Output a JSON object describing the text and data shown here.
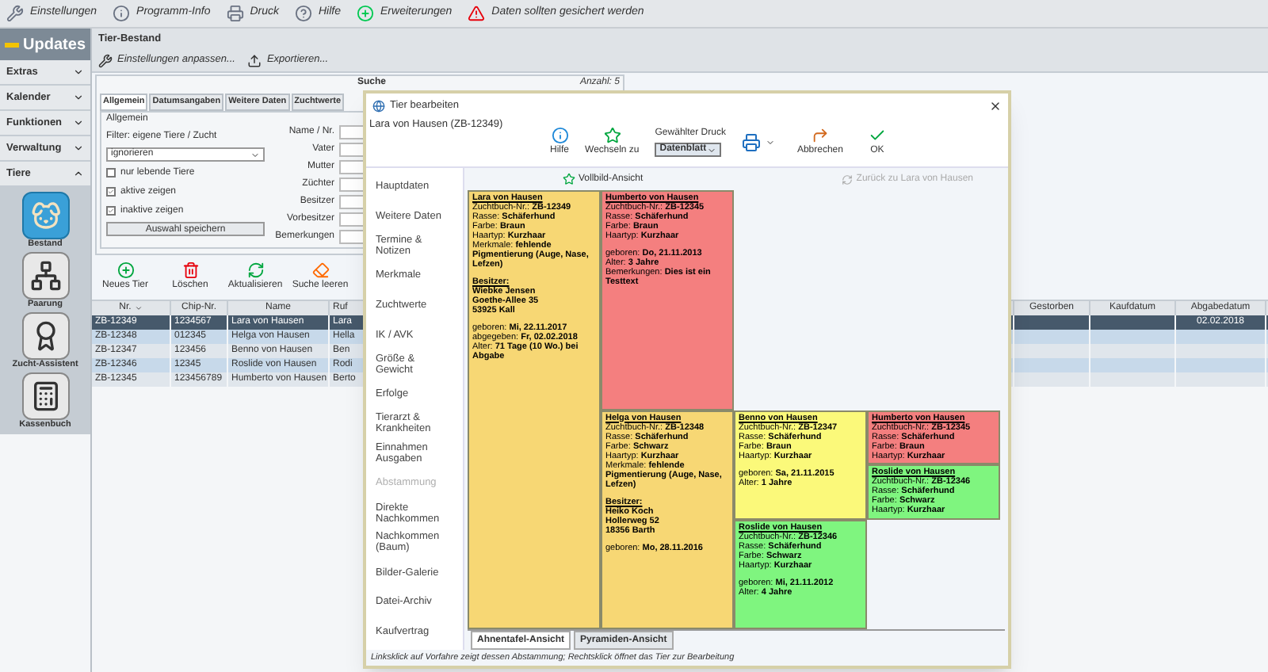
{
  "top_toolbar": [
    {
      "label": "Einstellungen"
    },
    {
      "label": "Programm-Info"
    },
    {
      "label": "Druck"
    },
    {
      "label": "Hilfe"
    },
    {
      "label": "Erweiterungen"
    },
    {
      "label": "Daten sollten gesichert werden"
    }
  ],
  "sidebar": {
    "title": "Updates",
    "sections": [
      {
        "label": "Extras",
        "expanded": false
      },
      {
        "label": "Kalender",
        "expanded": false
      },
      {
        "label": "Funktionen",
        "expanded": false
      },
      {
        "label": "Verwaltung",
        "expanded": false
      },
      {
        "label": "Tiere",
        "expanded": true
      }
    ],
    "modules": [
      {
        "label": "Bestand",
        "selected": true
      },
      {
        "label": "Paarung",
        "selected": false
      },
      {
        "label": "Zucht-Assistent",
        "selected": false
      },
      {
        "label": "Kassenbuch",
        "selected": false
      }
    ]
  },
  "main": {
    "title": "Tier-Bestand",
    "toolbar": [
      {
        "label": "Einstellungen anpassen..."
      },
      {
        "label": "Exportieren..."
      }
    ],
    "search": {
      "title": "Suche",
      "count": "Anzahl: 5",
      "tabs": [
        {
          "label": "Allgemein",
          "selected": true
        },
        {
          "label": "Datumsangaben",
          "selected": false
        },
        {
          "label": "Weitere Daten",
          "selected": false
        },
        {
          "label": "Zuchtwerte",
          "selected": false
        }
      ],
      "group_title": "Allgemein",
      "filter_label": "Filter: eigene Tiere / Zucht",
      "filter_value": "ignorieren",
      "checkboxes": [
        {
          "label": "nur lebende Tiere",
          "checked": false
        },
        {
          "label": "aktive zeigen",
          "checked": true
        },
        {
          "label": "inaktive zeigen",
          "checked": true
        }
      ],
      "save_button": "Auswahl speichern",
      "fields": [
        {
          "label": "Name / Nr."
        },
        {
          "label": "Vater"
        },
        {
          "label": "Mutter"
        },
        {
          "label": "Züchter"
        },
        {
          "label": "Besitzer"
        },
        {
          "label": "Vorbesitzer"
        },
        {
          "label": "Bemerkungen"
        }
      ]
    },
    "actions": [
      {
        "label": "Neues Tier"
      },
      {
        "label": "Löschen"
      },
      {
        "label": "Aktualisieren"
      },
      {
        "label": "Suche leeren"
      }
    ],
    "table": {
      "columns": [
        "Nr.",
        "Chip-Nr.",
        "Name",
        "Ruf",
        "Gestorben",
        "Kaufdatum",
        "Abgabedatum"
      ],
      "rows": [
        {
          "selected": true,
          "cells": [
            "ZB-12349",
            "1234567",
            "Lara von Hausen",
            "Lara",
            "",
            "",
            "02.02.2018"
          ]
        },
        {
          "selected": false,
          "cells": [
            "ZB-12348",
            "012345",
            "Helga von Hausen",
            "Hella",
            "",
            "",
            ""
          ]
        },
        {
          "selected": false,
          "cells": [
            "ZB-12347",
            "123456",
            "Benno von Hausen",
            "Ben",
            "",
            "",
            ""
          ]
        },
        {
          "selected": false,
          "cells": [
            "ZB-12346",
            "12345",
            "Roslide von Hausen",
            "Rodi",
            "",
            "",
            ""
          ]
        },
        {
          "selected": false,
          "cells": [
            "ZB-12345",
            "123456789",
            "Humberto von Hausen",
            "Berto",
            "",
            "",
            ""
          ]
        }
      ]
    }
  },
  "dialog": {
    "title": "Tier bearbeiten",
    "subtitle": "Lara von Hausen (ZB-12349)",
    "toolbar": {
      "help": "Hilfe",
      "switch": "Wechseln zu",
      "print_label": "Gewählter Druck",
      "print_value": "Datenblatt",
      "cancel": "Abbrechen",
      "ok": "OK"
    },
    "nav": [
      {
        "label": "Hauptdaten",
        "selected": false
      },
      {
        "label": "Weitere Daten",
        "selected": false
      },
      {
        "label": "Termine & Notizen",
        "selected": false
      },
      {
        "label": "Merkmale",
        "selected": false
      },
      {
        "label": "Zuchtwerte",
        "selected": false
      },
      {
        "label": "IK / AVK",
        "selected": false
      },
      {
        "label": "Größe & Gewicht",
        "selected": false
      },
      {
        "label": "Erfolge",
        "selected": false
      },
      {
        "label": "Tierarzt & Krankheiten",
        "selected": false
      },
      {
        "label": "Einnahmen Ausgaben",
        "selected": false
      },
      {
        "label": "Abstammung",
        "selected": true
      },
      {
        "label": "Direkte Nachkommen",
        "selected": false
      },
      {
        "label": "Nachkommen (Baum)",
        "selected": false
      },
      {
        "label": "Bilder-Galerie",
        "selected": false
      },
      {
        "label": "Datei-Archiv",
        "selected": false
      },
      {
        "label": "Kaufvertrag",
        "selected": false
      }
    ],
    "fullscreen": "Vollbild-Ansicht",
    "back": {
      "label": "Zurück zu Lara von Hausen",
      "disabled": true
    },
    "pedigree": {
      "name": "Lara von Hausen",
      "color": "#f7d774",
      "sections": [
        [
          {
            "label": "Zuchtbuch-Nr.:",
            "value": "ZB-12349"
          },
          {
            "label": "Rasse:",
            "value": "Schäferhund"
          },
          {
            "label": "Farbe:",
            "value": "Braun"
          },
          {
            "label": "Haartyp:",
            "value": "Kurzhaar"
          },
          {
            "label": "Merkmale:",
            "value": "fehlende Pigmentierung (Auge, Nase, Lefzen)"
          }
        ],
        [
          {
            "heading": "Besitzer:"
          },
          {
            "value": "Wiebke Jensen"
          },
          {
            "value": "Goethe-Allee 35"
          },
          {
            "value": "53925 Kall"
          }
        ],
        [
          {
            "label": "geboren:",
            "value": "Mi, 22.11.2017"
          },
          {
            "label": "abgegeben:",
            "value": "Fr, 02.02.2018"
          },
          {
            "label": "Alter:",
            "value": "71 Tage (10 Wo.) bei Abgabe"
          }
        ]
      ],
      "parents": [
        {
          "name": "Humberto von Hausen",
          "color": "#f47f7f",
          "sections": [
            [
              {
                "label": "Zuchtbuch-Nr.:",
                "value": "ZB-12345"
              },
              {
                "label": "Rasse:",
                "value": "Schäferhund"
              },
              {
                "label": "Farbe:",
                "value": "Braun"
              },
              {
                "label": "Haartyp:",
                "value": "Kurzhaar"
              }
            ],
            [
              {
                "label": "geboren:",
                "value": "Do, 21.11.2013"
              },
              {
                "label": "Alter:",
                "value": "3 Jahre"
              },
              {
                "label": "Bemerkungen:",
                "value": "Dies ist ein Testtext"
              }
            ]
          ]
        },
        {
          "name": "Helga von Hausen",
          "color": "#f7d774",
          "sections": [
            [
              {
                "label": "Zuchtbuch-Nr.:",
                "value": "ZB-12348"
              },
              {
                "label": "Rasse:",
                "value": "Schäferhund"
              },
              {
                "label": "Farbe:",
                "value": "Schwarz"
              },
              {
                "label": "Haartyp:",
                "value": "Kurzhaar"
              },
              {
                "label": "Merkmale:",
                "value": "fehlende Pigmentierung (Auge, Nase, Lefzen)"
              }
            ],
            [
              {
                "heading": "Besitzer:"
              },
              {
                "value": "Heiko Koch"
              },
              {
                "value": "Hollerweg 52"
              },
              {
                "value": "18356 Barth"
              }
            ],
            [
              {
                "label": "geboren:",
                "value": "Mo, 28.11.2016"
              }
            ]
          ],
          "parents": [
            {
              "name": "Benno von Hausen",
              "color": "#fbf97a",
              "sections": [
                [
                  {
                    "label": "Zuchtbuch-Nr.:",
                    "value": "ZB-12347"
                  },
                  {
                    "label": "Rasse:",
                    "value": "Schäferhund"
                  },
                  {
                    "label": "Farbe:",
                    "value": "Braun"
                  },
                  {
                    "label": "Haartyp:",
                    "value": "Kurzhaar"
                  }
                ],
                [
                  {
                    "label": "geboren:",
                    "value": "Sa, 21.11.2015"
                  },
                  {
                    "label": "Alter:",
                    "value": "1 Jahre"
                  }
                ]
              ],
              "parents": [
                {
                  "name": "Humberto von Hausen",
                  "color": "#f47f7f",
                  "sections": [
                    [
                      {
                        "label": "Zuchtbuch-Nr.:",
                        "value": "ZB-12345"
                      },
                      {
                        "label": "Rasse:",
                        "value": "Schäferhund"
                      },
                      {
                        "label": "Farbe:",
                        "value": "Braun"
                      },
                      {
                        "label": "Haartyp:",
                        "value": "Kurzhaar"
                      }
                    ]
                  ]
                },
                {
                  "name": "Roslide von Hausen",
                  "color": "#7ff57f",
                  "sections": [
                    [
                      {
                        "label": "Zuchtbuch-Nr.:",
                        "value": "ZB-12346"
                      },
                      {
                        "label": "Rasse:",
                        "value": "Schäferhund"
                      },
                      {
                        "label": "Farbe:",
                        "value": "Schwarz"
                      },
                      {
                        "label": "Haartyp:",
                        "value": "Kurzhaar"
                      }
                    ]
                  ]
                }
              ]
            },
            {
              "name": "Roslide von Hausen",
              "color": "#7ff57f",
              "sections": [
                [
                  {
                    "label": "Zuchtbuch-Nr.:",
                    "value": "ZB-12346"
                  },
                  {
                    "label": "Rasse:",
                    "value": "Schäferhund"
                  },
                  {
                    "label": "Farbe:",
                    "value": "Schwarz"
                  },
                  {
                    "label": "Haartyp:",
                    "value": "Kurzhaar"
                  }
                ],
                [
                  {
                    "label": "geboren:",
                    "value": "Mi, 21.11.2012"
                  },
                  {
                    "label": "Alter:",
                    "value": "4 Jahre"
                  }
                ]
              ]
            }
          ]
        }
      ]
    },
    "view_tabs": [
      {
        "label": "Ahnentafel-Ansicht",
        "selected": true
      },
      {
        "label": "Pyramiden-Ansicht",
        "selected": false
      }
    ],
    "status": "Linksklick auf Vorfahre zeigt dessen Abstammung; Rechtsklick öffnet das Tier zur Bearbeitung"
  }
}
